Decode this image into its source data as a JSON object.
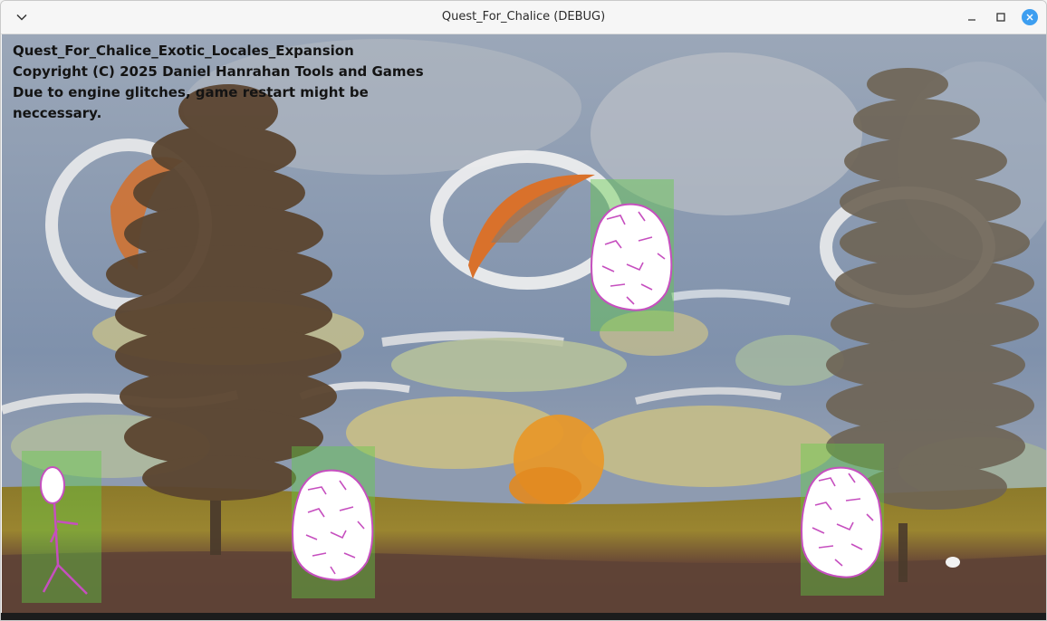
{
  "window": {
    "title": "Quest_For_Chalice (DEBUG)",
    "icons": {
      "menu": "chevron-down-icon",
      "minimize": "minimize-icon",
      "maximize": "maximize-icon",
      "close": "close-icon"
    },
    "accent_color": "#3d9ef0"
  },
  "game": {
    "info_lines": [
      "Quest_For_Chalice_Exotic_Locales_Expansion",
      "Copyright (C) 2025 Daniel Hanrahan Tools and Games",
      "Due to engine glitches, game restart might be",
      "neccessary."
    ],
    "hitbox_color": "#62cd46",
    "entities": [
      {
        "kind": "player",
        "icon": "stick-figure-icon"
      },
      {
        "kind": "egg",
        "icon": "cracked-egg-icon"
      },
      {
        "kind": "egg",
        "icon": "cracked-egg-icon"
      },
      {
        "kind": "egg",
        "icon": "cracked-egg-icon"
      }
    ]
  }
}
